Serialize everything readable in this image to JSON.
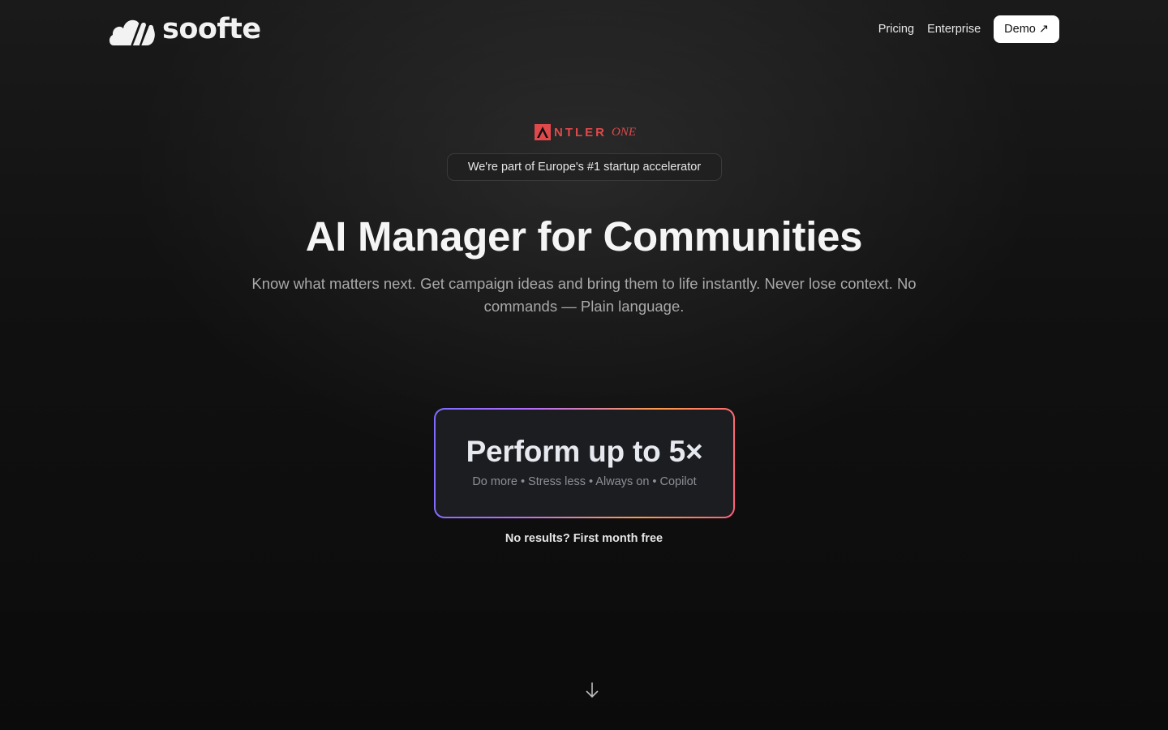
{
  "header": {
    "logo_text": "soofte",
    "nav": {
      "pricing": "Pricing",
      "enterprise": "Enterprise",
      "demo": "Demo",
      "demo_arrow": "↗"
    }
  },
  "hero": {
    "antler_word": "NTLER",
    "antler_one": "ONE",
    "badge": "We're part of Europe's #1 startup accelerator",
    "title": "AI Manager for Communities",
    "subtitle": "Know what matters next. Get campaign ideas and bring them to life instantly. Never lose context. No commands — Plain language.",
    "card": {
      "title": "Perform up to 5×",
      "subtitle": "Do more • Stress less • Always on • Copilot"
    },
    "guarantee": "No results? First month free"
  },
  "icons": {
    "logo": "soofte-cloud-logo-icon",
    "antler": "antler-a-icon",
    "scroll": "arrow-down-icon"
  },
  "colors": {
    "background": "#111111",
    "antler_red": "#e0494b",
    "card_gradient": [
      "#7b6cff",
      "#b56cff",
      "#ff9a4a",
      "#ff5e7a"
    ]
  }
}
